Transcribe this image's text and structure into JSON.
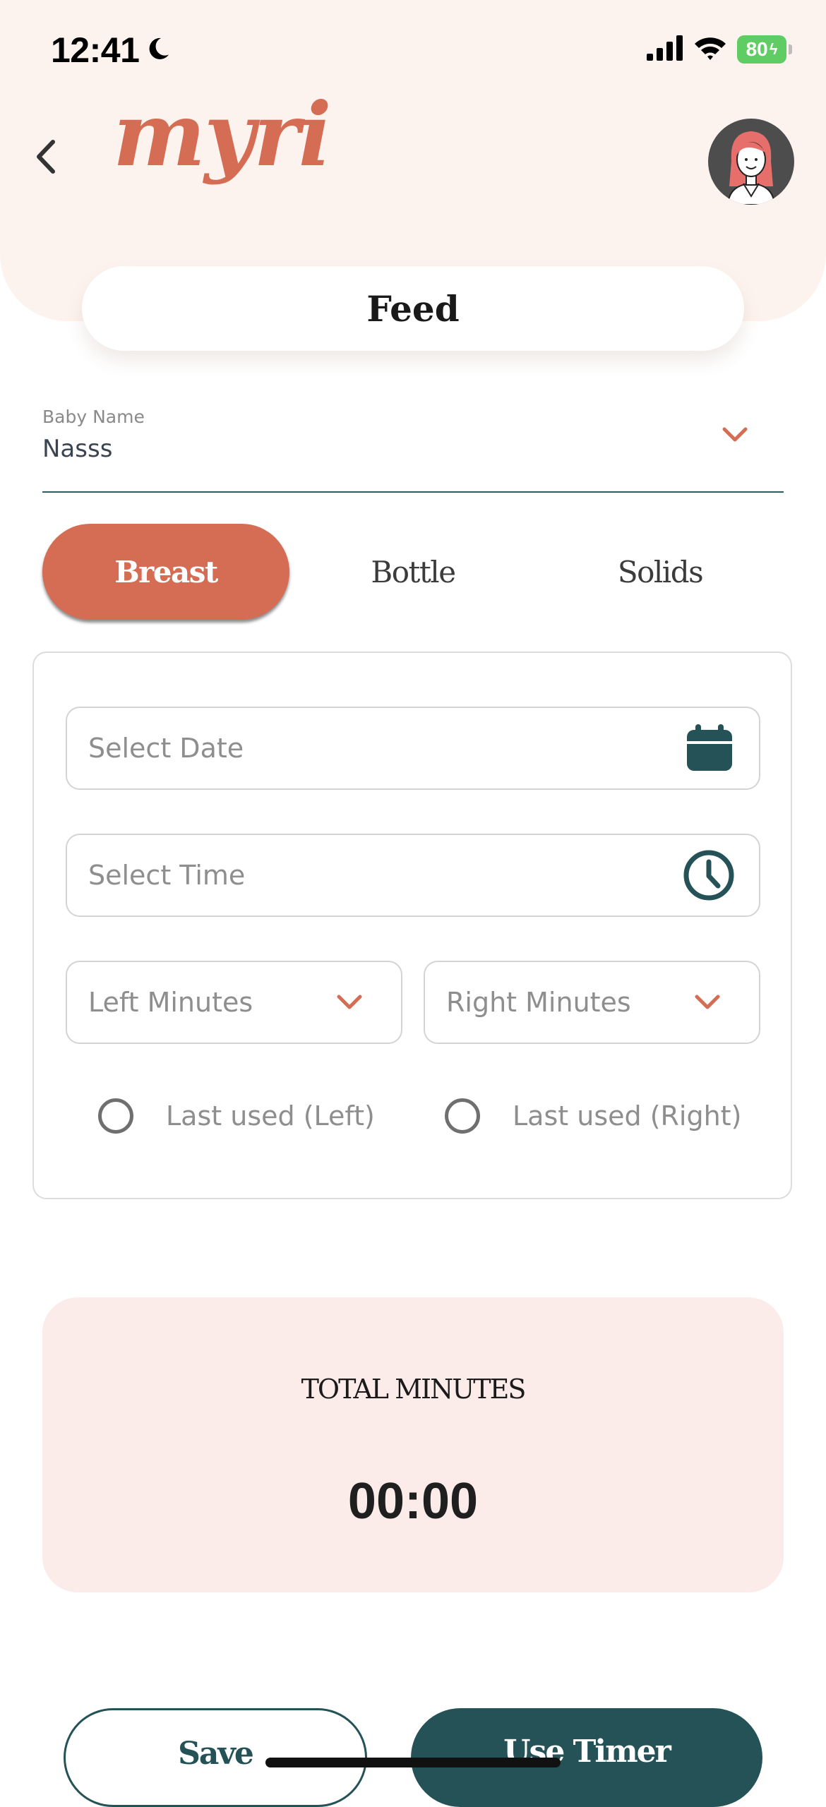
{
  "status_bar": {
    "time": "12:41",
    "battery": "80"
  },
  "header": {
    "logo": "myri",
    "title": "Feed"
  },
  "baby_field": {
    "label": "Baby Name",
    "value": "Nasss"
  },
  "tabs": [
    {
      "label": "Breast",
      "active": true
    },
    {
      "label": "Bottle",
      "active": false
    },
    {
      "label": "Solids",
      "active": false
    }
  ],
  "form": {
    "date_placeholder": "Select Date",
    "time_placeholder": "Select Time",
    "left_minutes": "Left Minutes",
    "right_minutes": "Right Minutes",
    "last_used_left": "Last used (Left)",
    "last_used_right": "Last used (Right)"
  },
  "total": {
    "label": "TOTAL MINUTES",
    "value": "00:00"
  },
  "buttons": {
    "save": "Save",
    "use_timer": "Use Timer"
  },
  "colors": {
    "accent": "#d56c54",
    "teal": "#245257",
    "header_bg": "#fdf3ee",
    "total_bg": "#fbecea"
  },
  "icons": [
    "moon-icon",
    "signal-icon",
    "wifi-icon",
    "battery-icon",
    "back-chevron-icon",
    "avatar-icon",
    "chevron-down-icon",
    "calendar-icon",
    "clock-icon"
  ]
}
